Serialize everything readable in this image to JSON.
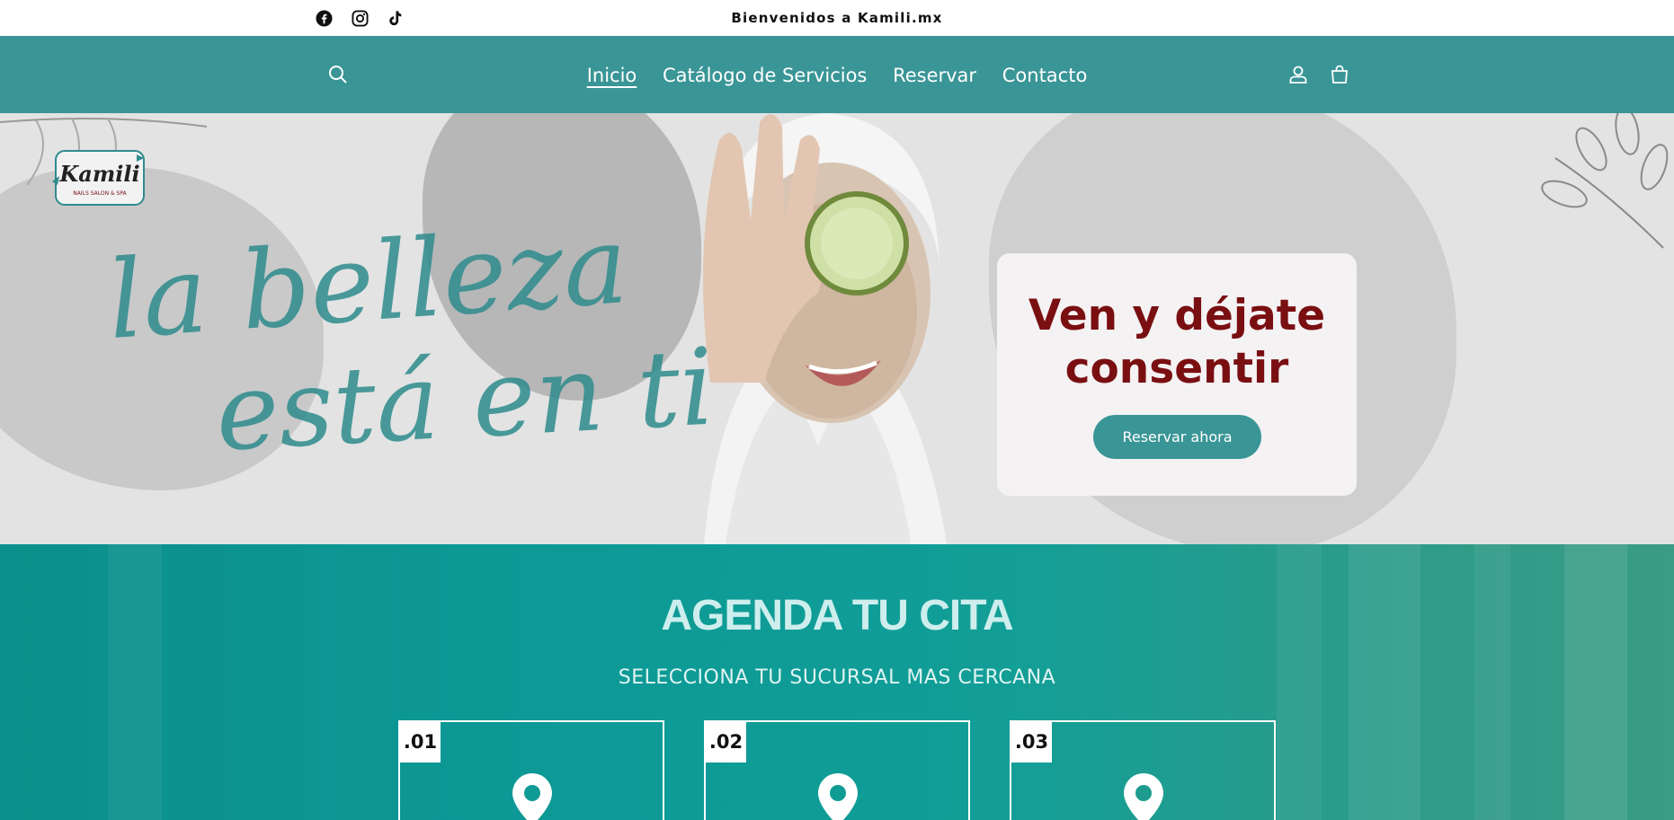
{
  "topbar": {
    "social": [
      {
        "name": "facebook-icon"
      },
      {
        "name": "instagram-icon"
      },
      {
        "name": "tiktok-icon"
      }
    ],
    "welcome": "Bienvenidos a Kamili.mx"
  },
  "nav": {
    "links": [
      {
        "label": "Inicio",
        "active": true
      },
      {
        "label": "Catálogo de Servicios",
        "active": false
      },
      {
        "label": "Reservar",
        "active": false
      },
      {
        "label": "Contacto",
        "active": false
      }
    ],
    "icons": [
      "search-icon",
      "account-icon",
      "cart-icon"
    ]
  },
  "hero": {
    "logo_text": "Kamili",
    "logo_subtext": "NAILS SALON & SPA",
    "script_line1": "la belleza",
    "script_line2": "está en ti",
    "card_title": "Ven y déjate consentir",
    "card_button": "Reservar ahora"
  },
  "agenda": {
    "title": "AGENDA TU CITA",
    "subtitle": "SELECCIONA TU SUCURSAL MAS CERCANA",
    "locations": [
      {
        "number": ".01"
      },
      {
        "number": ".02"
      },
      {
        "number": ".03"
      }
    ]
  },
  "colors": {
    "teal": "#3a9596",
    "maroon": "#7a0f12"
  }
}
